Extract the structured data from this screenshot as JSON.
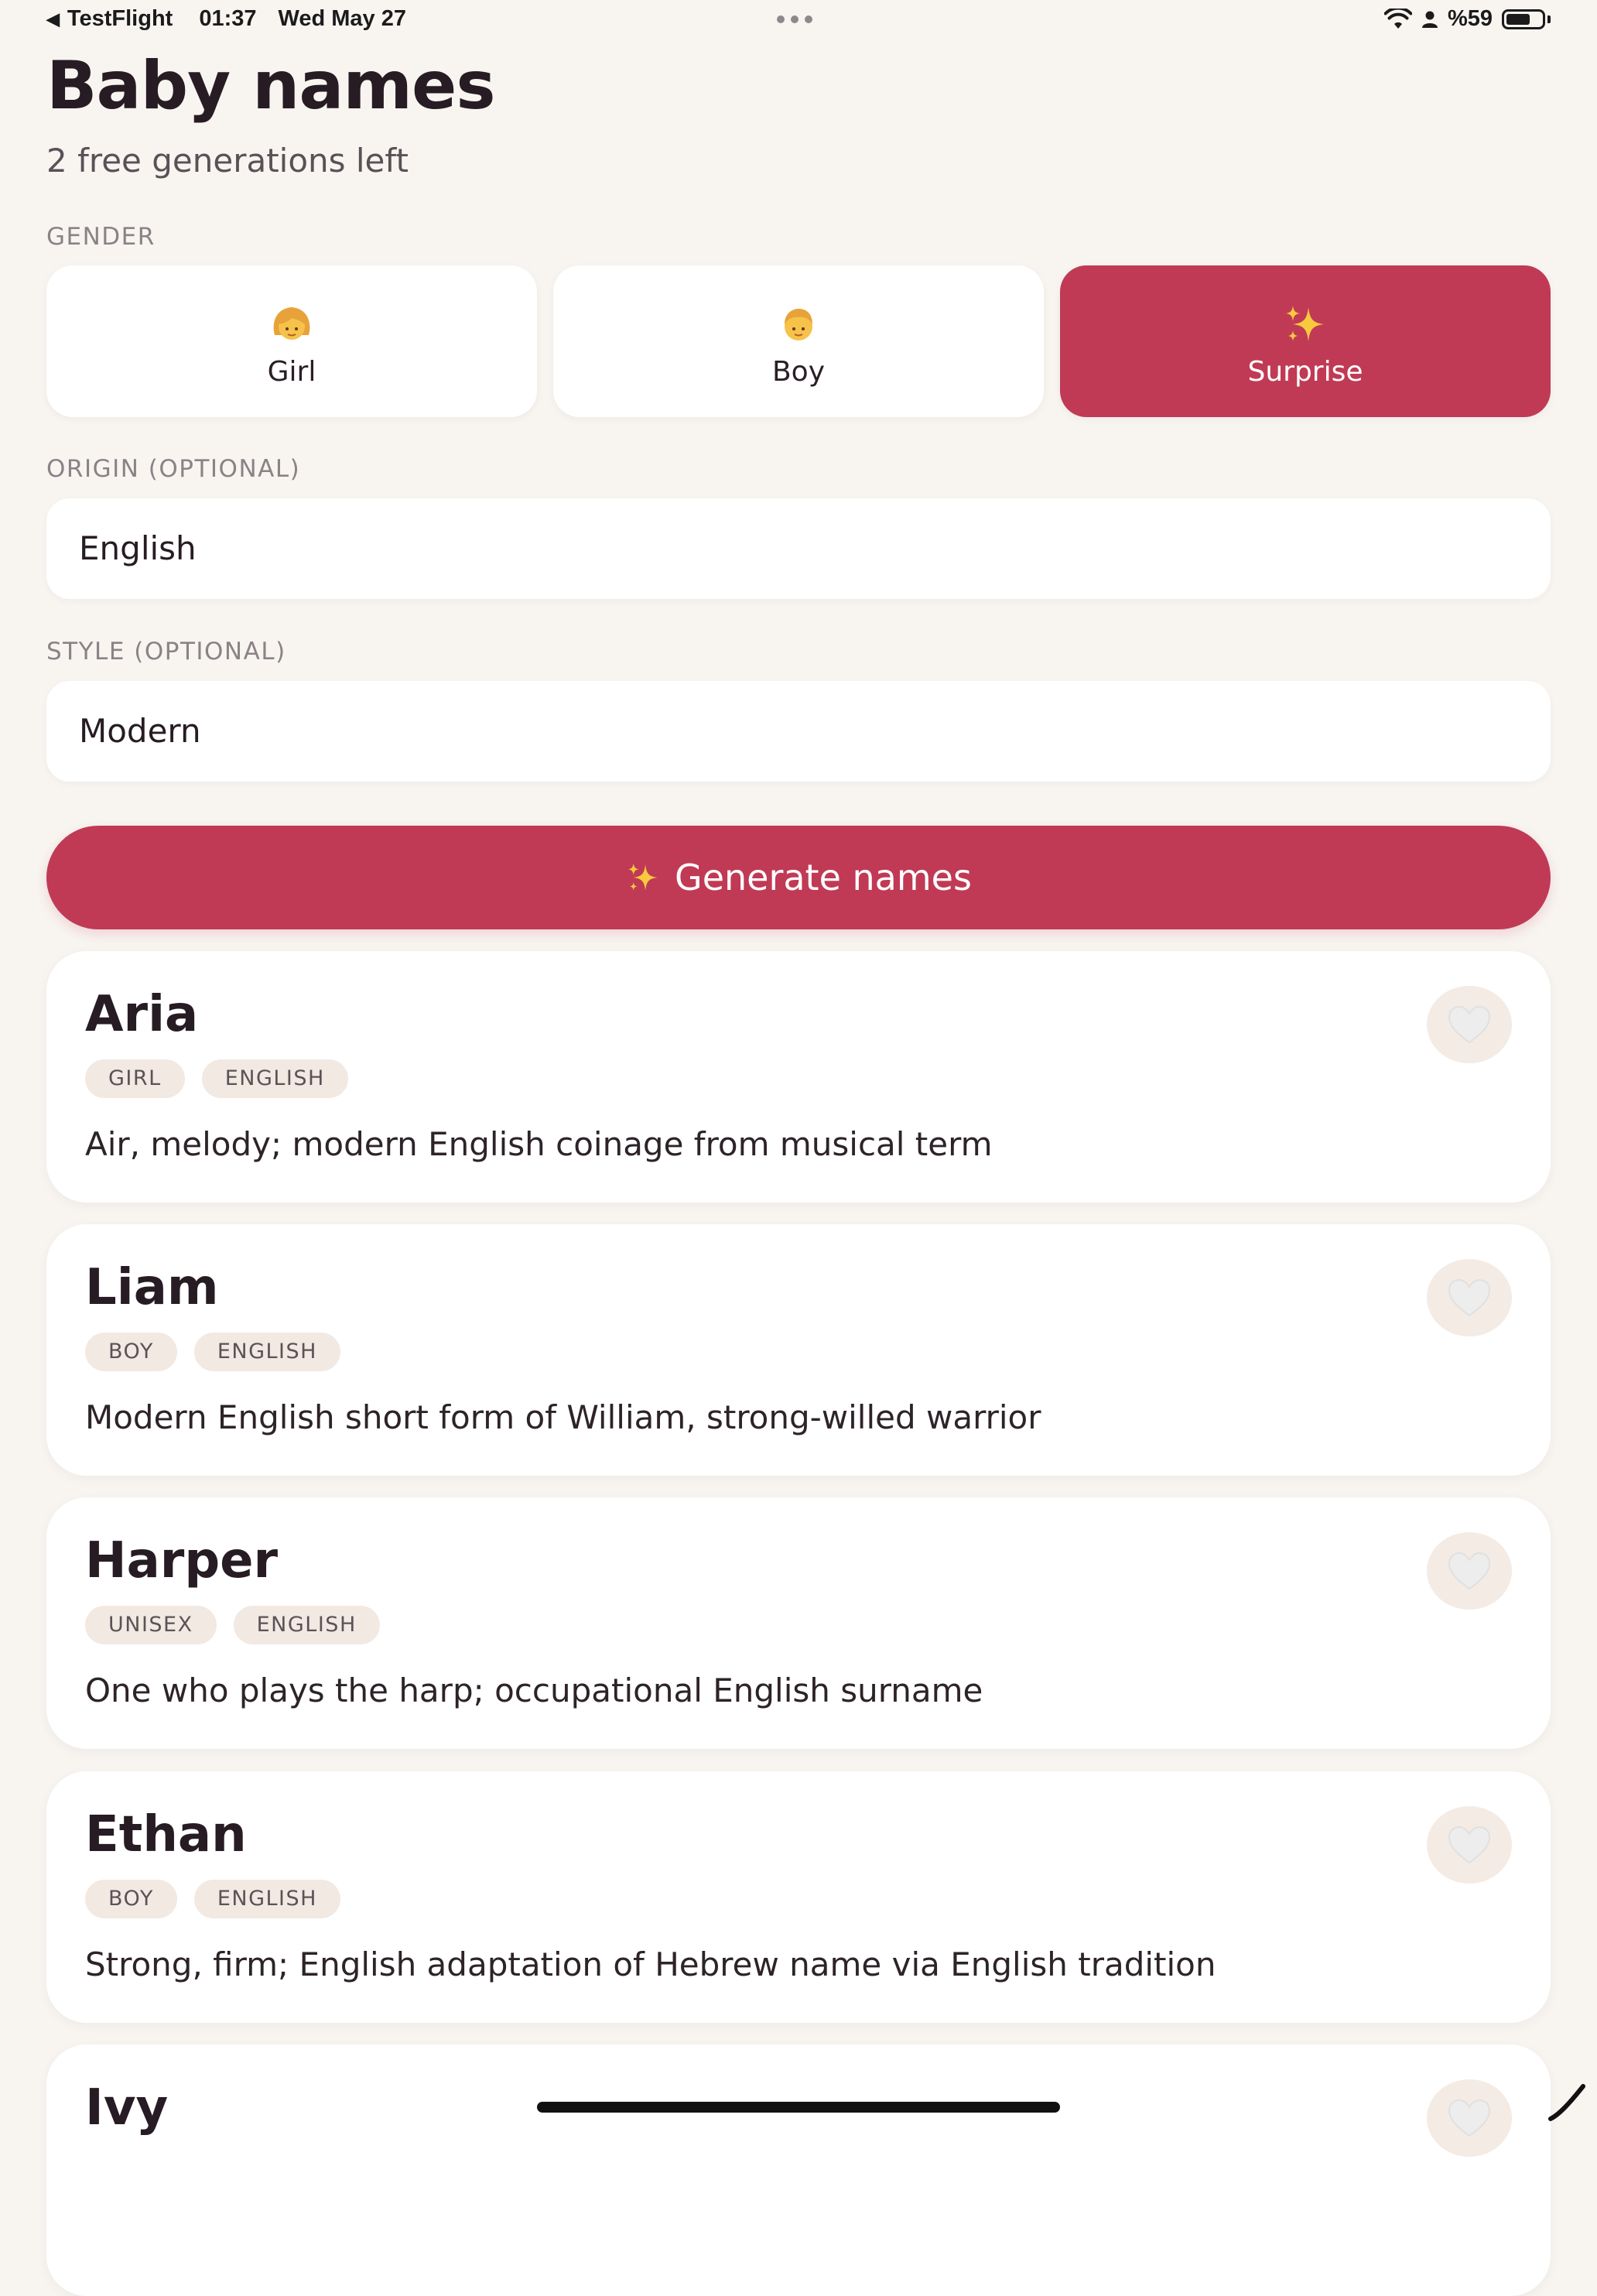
{
  "status_bar": {
    "back_app": "TestFlight",
    "time": "01:37",
    "date": "Wed May 27",
    "battery_text": "%59",
    "battery_level": 0.59
  },
  "header": {
    "title": "Baby names",
    "subtitle": "2 free generations left"
  },
  "gender": {
    "label": "GENDER",
    "options": [
      {
        "label": "Girl",
        "icon": "girl-face-icon",
        "selected": false
      },
      {
        "label": "Boy",
        "icon": "boy-face-icon",
        "selected": false
      },
      {
        "label": "Surprise",
        "icon": "sparkles-icon",
        "selected": true
      }
    ]
  },
  "origin": {
    "label": "ORIGIN (OPTIONAL)",
    "value": "English"
  },
  "style": {
    "label": "STYLE (OPTIONAL)",
    "value": "Modern"
  },
  "generate_button": {
    "label": "Generate names",
    "icon": "sparkles-icon"
  },
  "names": [
    {
      "name": "Aria",
      "tags": [
        "GIRL",
        "ENGLISH"
      ],
      "description": "Air, melody; modern English coinage from musical term",
      "favorited": false
    },
    {
      "name": "Liam",
      "tags": [
        "BOY",
        "ENGLISH"
      ],
      "description": "Modern English short form of William, strong-willed warrior",
      "favorited": false
    },
    {
      "name": "Harper",
      "tags": [
        "UNISEX",
        "ENGLISH"
      ],
      "description": "One who plays the harp; occupational English surname",
      "favorited": false
    },
    {
      "name": "Ethan",
      "tags": [
        "BOY",
        "ENGLISH"
      ],
      "description": "Strong, firm; English adaptation of Hebrew name via English tradition",
      "favorited": false
    },
    {
      "name": "Ivy",
      "tags": [],
      "description": "",
      "favorited": false
    }
  ],
  "colors": {
    "accent": "#c03a55",
    "background": "#f8f5f1",
    "card": "#ffffff",
    "tag_bg": "#f1e9e2",
    "text_primary": "#271c23",
    "text_secondary": "#8b8286"
  }
}
